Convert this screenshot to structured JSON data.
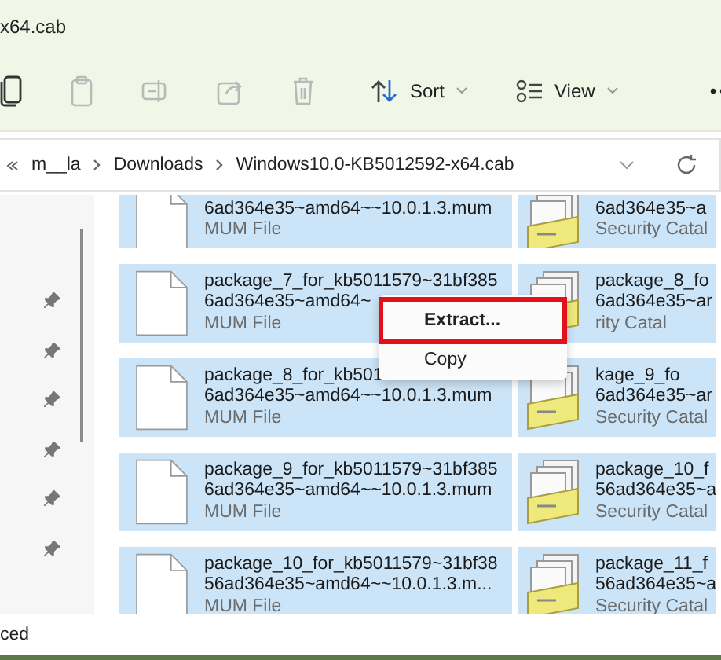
{
  "window": {
    "title": "x64.cab"
  },
  "toolbar": {
    "sort": "Sort",
    "view": "View"
  },
  "address": {
    "path": [
      {
        "label": "m__la"
      },
      {
        "label": "Downloads"
      },
      {
        "label": "Windows10.0-KB5012592-x64.cab"
      }
    ]
  },
  "rows": [
    {
      "left": {
        "kind": "mum",
        "lines": [
          "6ad364e35~amd64~~10.0.1.3.mum"
        ],
        "type": "MUM File",
        "selected": true
      },
      "right": {
        "kind": "catalog",
        "lines": [
          "6ad364e35~a"
        ],
        "type": "Security Catal",
        "selected": true
      }
    },
    {
      "left": {
        "kind": "mum",
        "lines": [
          "package_7_for_kb5011579~31bf385",
          "6ad364e35~amd64~"
        ],
        "type": "MUM File",
        "selected": true
      },
      "right": {
        "kind": "catalog",
        "lines": [
          "package_8_fo",
          "6ad364e35~ar"
        ],
        "type": "rity Catal",
        "selected": true
      }
    },
    {
      "left": {
        "kind": "mum",
        "lines": [
          "package_8_for_kb501",
          "6ad364e35~amd64~~10.0.1.3.mum"
        ],
        "type": "MUM File",
        "selected": true
      },
      "right": {
        "kind": "catalog",
        "lines": [
          "kage_9_fo",
          "6ad364e35~ar"
        ],
        "type": "Security Catal",
        "selected": true
      }
    },
    {
      "left": {
        "kind": "mum",
        "lines": [
          "package_9_for_kb5011579~31bf385",
          "6ad364e35~amd64~~10.0.1.3.mum"
        ],
        "type": "MUM File",
        "selected": true
      },
      "right": {
        "kind": "catalog",
        "lines": [
          "package_10_f",
          "56ad364e35~a"
        ],
        "type": "Security Catal",
        "selected": true
      }
    },
    {
      "left": {
        "kind": "mum",
        "lines": [
          "package_10_for_kb5011579~31bf38",
          "56ad364e35~amd64~~10.0.1.3.m..."
        ],
        "type": "MUM File",
        "selected": true
      },
      "right": {
        "kind": "catalog",
        "lines": [
          "package_11_f",
          "56ad364e35~a"
        ],
        "type": "Security Catal",
        "selected": true
      }
    }
  ],
  "context_menu": {
    "items": [
      {
        "label": "Extract...",
        "default": true,
        "highlighted": true
      },
      {
        "label": "Copy",
        "default": false,
        "highlighted": false
      }
    ]
  },
  "status_bar": {
    "text": "ced"
  }
}
